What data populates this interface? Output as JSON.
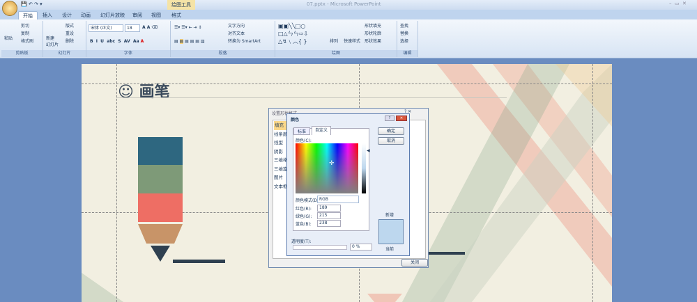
{
  "window": {
    "title": "07.pptx - Microsoft PowerPoint",
    "context_tab": "绘图工具"
  },
  "tabs": [
    "开始",
    "插入",
    "设计",
    "动画",
    "幻灯片放映",
    "审阅",
    "视图",
    "格式"
  ],
  "ribbon": {
    "clipboard": {
      "label": "剪贴板",
      "paste": "粘贴",
      "cut": "剪切",
      "copy": "复制",
      "format_painter": "格式刷"
    },
    "slides": {
      "label": "幻灯片",
      "new_slide": "新建\n幻灯片",
      "layout": "版式",
      "reset": "重设",
      "delete": "删除"
    },
    "font": {
      "label": "字体",
      "font_name": "宋体 (正文)",
      "font_size": "18"
    },
    "paragraph": {
      "label": "段落",
      "text_direction": "文字方向",
      "align_text": "对齐文本",
      "smartart": "转换为 SmartArt"
    },
    "drawing": {
      "label": "绘图",
      "arrange": "排列",
      "quick_styles": "快速样式",
      "shape_fill": "形状填充",
      "shape_outline": "形状轮廓",
      "shape_effects": "形状效果"
    },
    "editing": {
      "label": "编辑",
      "find": "查找",
      "replace": "替换",
      "select": "选择"
    }
  },
  "slide": {
    "title": "画笔",
    "title_icon": "smiley-icon",
    "colors": {
      "teal": "#2e6780",
      "green": "#7e9a78",
      "salmon": "#ee6e64",
      "tan": "#c89468",
      "dark": "#2f4050"
    }
  },
  "format_dialog": {
    "title": "设置形状格式",
    "items": [
      "填充",
      "线条颜色",
      "线型",
      "阴影",
      "三维格式",
      "三维旋转",
      "图片",
      "文本框"
    ],
    "close": "关闭"
  },
  "color_dialog": {
    "title": "颜色",
    "tabs": [
      "标准",
      "自定义"
    ],
    "ok": "确定",
    "cancel": "取消",
    "colors_label": "颜色(C):",
    "model_label": "颜色模式(D):",
    "model": "RGB",
    "red_label": "红色(R):",
    "red": "189",
    "green_label": "绿色(G):",
    "green": "215",
    "blue_label": "蓝色(B):",
    "blue": "238",
    "transparency_label": "透明度(T):",
    "transparency": "0 %",
    "new_label": "新增",
    "current_label": "当前",
    "new_color": "#bdd7ee"
  }
}
